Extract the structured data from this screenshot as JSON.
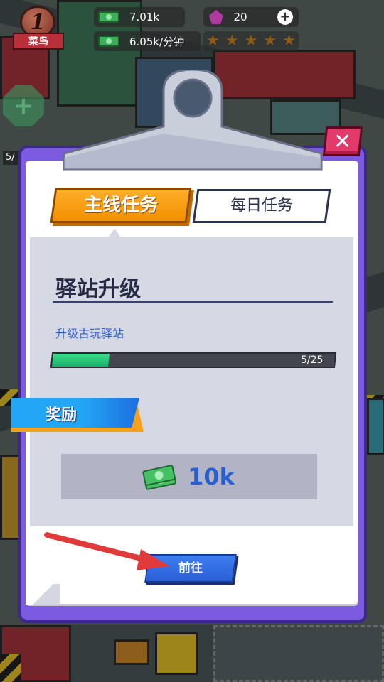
{
  "hud": {
    "rank_level": "1",
    "rank_title": "菜鸟",
    "cash": "7.01k",
    "income_rate": "6.05k/分钟",
    "gems": "20",
    "plus_icon": "plus-icon",
    "stars": 5,
    "side_counter": "5/"
  },
  "dialog": {
    "tabs": {
      "main": "主线任务",
      "daily": "每日任务"
    },
    "task": {
      "title": "驿站升级",
      "description": "升级古玩驿站",
      "progress_text": "5/25",
      "progress_current": 5,
      "progress_total": 25
    },
    "reward": {
      "label": "奖励",
      "amount": "10k",
      "icon": "cash-icon"
    },
    "go_button": "前往",
    "close_icon": "close-icon"
  },
  "colors": {
    "panel": "#7c5be0",
    "tab_active": "#f7a00f",
    "progress_fill": "#2bd07c",
    "go_button": "#2f6ae0",
    "close_button": "#e23a6a",
    "arrow": "#e03a3a"
  }
}
